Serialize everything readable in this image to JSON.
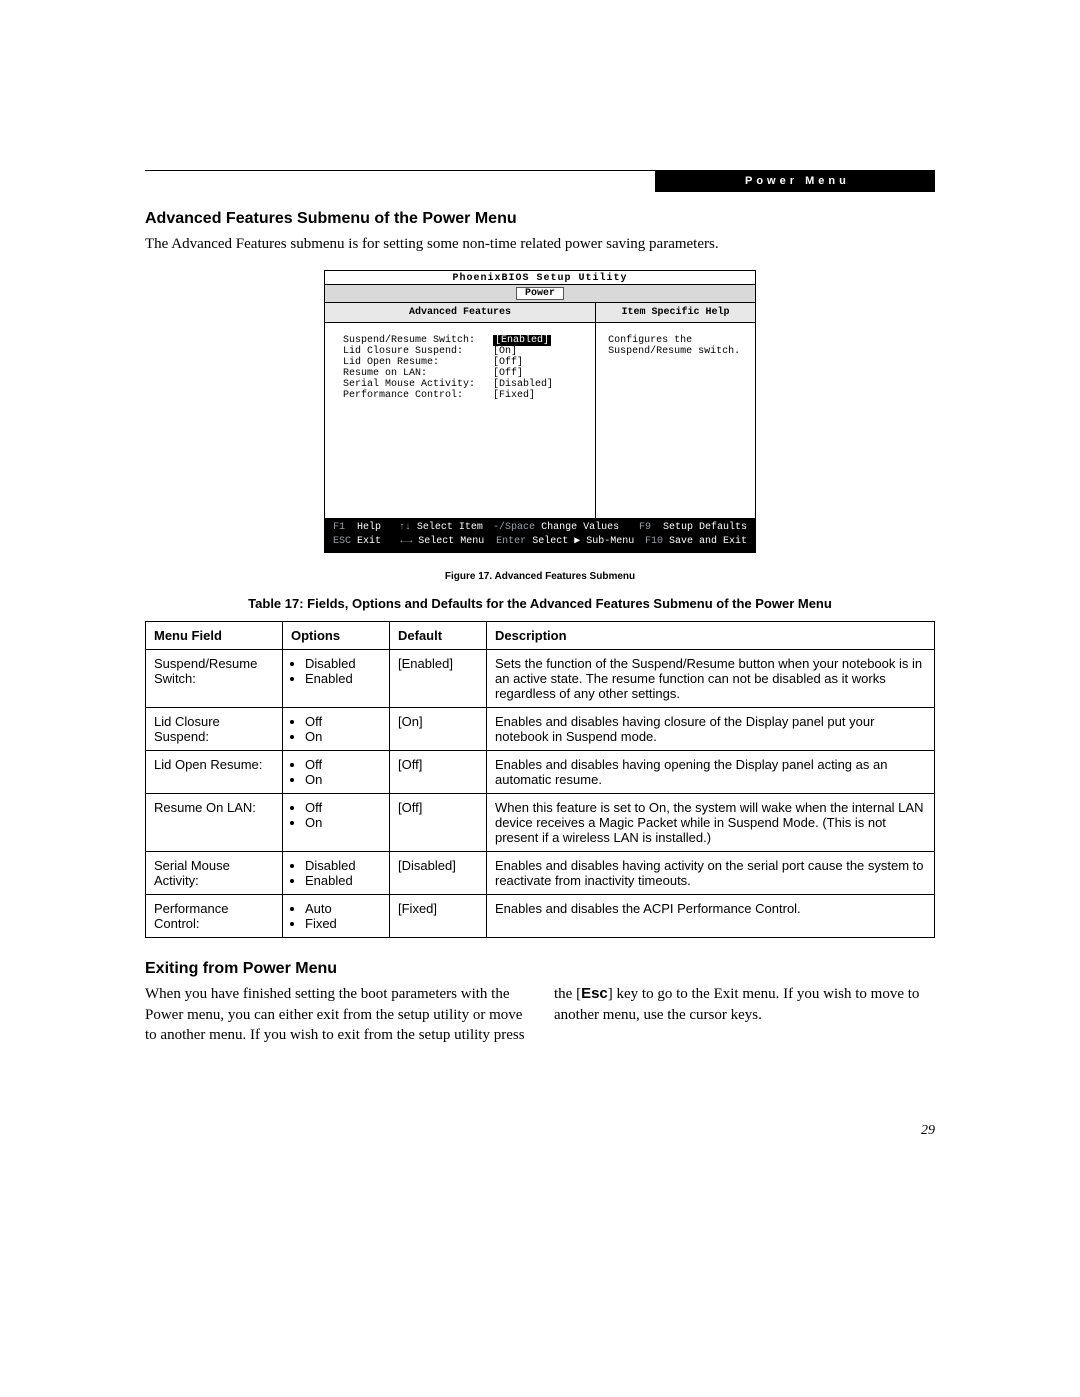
{
  "header": {
    "section_label": "Power Menu"
  },
  "section1": {
    "title": "Advanced Features Submenu of the Power Menu",
    "intro": "The Advanced Features submenu is for setting some non-time related power saving parameters."
  },
  "bios": {
    "utility_title": "PhoenixBIOS Setup Utility",
    "active_tab": "Power",
    "left_title": "Advanced Features",
    "right_title": "Item Specific Help",
    "help_text1": "Configures the",
    "help_text2": "Suspend/Resume switch.",
    "fields": [
      {
        "label": "Suspend/Resume Switch:",
        "value": "[Enabled]",
        "selected": true
      },
      {
        "label": "Lid Closure Suspend:",
        "value": "[On]"
      },
      {
        "label": "Lid Open Resume:",
        "value": "[Off]"
      },
      {
        "label": "Resume on LAN:",
        "value": "[Off]"
      },
      {
        "label": "Serial Mouse Activity:",
        "value": "[Disabled]"
      },
      {
        "label": "Performance Control:",
        "value": "[Fixed]"
      }
    ],
    "footer": {
      "r1c1k": "F1",
      "r1c1t": "Help",
      "r1c2k": "↑↓",
      "r1c2t": "Select Item",
      "r1c3k": "-/Space",
      "r1c3t": "Change Values",
      "r1c4k": "F9",
      "r1c4t": "Setup Defaults",
      "r2c1k": "ESC",
      "r2c1t": "Exit",
      "r2c2k": "←→",
      "r2c2t": "Select Menu",
      "r2c3k": "Enter",
      "r2c3t": "Select ▶ Sub-Menu",
      "r2c4k": "F10",
      "r2c4t": "Save and Exit"
    }
  },
  "figure_caption": "Figure 17.  Advanced Features Submenu",
  "table_title": "Table 17: Fields, Options and Defaults for the Advanced Features Submenu of the Power Menu",
  "table": {
    "headers": {
      "c1": "Menu Field",
      "c2": "Options",
      "c3": "Default",
      "c4": "Description"
    },
    "rows": [
      {
        "field": "Suspend/Resume Switch:",
        "opt1": "Disabled",
        "opt2": "Enabled",
        "def": "[Enabled]",
        "desc": "Sets the function of the Suspend/Resume button when your notebook is in an active state. The resume function can not be disabled as it works regardless of any other settings."
      },
      {
        "field": "Lid Closure Suspend:",
        "opt1": "Off",
        "opt2": "On",
        "def": "[On]",
        "desc": "Enables and disables having closure of the Display panel put your notebook in Suspend mode."
      },
      {
        "field": "Lid Open Resume:",
        "opt1": "Off",
        "opt2": "On",
        "def": "[Off]",
        "desc": "Enables and disables having opening the Display panel acting as an automatic resume."
      },
      {
        "field": "Resume On LAN:",
        "opt1": "Off",
        "opt2": "On",
        "def": "[Off]",
        "desc": "When this feature is set to On, the system will wake when the internal LAN device receives a Magic Packet while in Suspend Mode. (This is not present if a wireless LAN is installed.)"
      },
      {
        "field": "Serial Mouse Activity:",
        "opt1": "Disabled",
        "opt2": "Enabled",
        "def": "[Disabled]",
        "desc": "Enables and disables having activity on the serial port cause the system to reactivate from inactivity timeouts."
      },
      {
        "field": "Performance Control:",
        "opt1": "Auto",
        "opt2": "Fixed",
        "def": "[Fixed]",
        "desc": "Enables and disables the ACPI Performance Control."
      }
    ]
  },
  "section2": {
    "title": "Exiting from Power Menu",
    "para_a": "When you have finished setting the boot parameters with the Power menu, you can either exit from the setup utility or move to another menu. If you wish to exit from ",
    "para_b": "the setup utility press the [",
    "esc": "Esc",
    "para_c": "] key to go to the Exit menu. If you wish to move to another menu, use the cursor keys."
  },
  "page_number": "29"
}
